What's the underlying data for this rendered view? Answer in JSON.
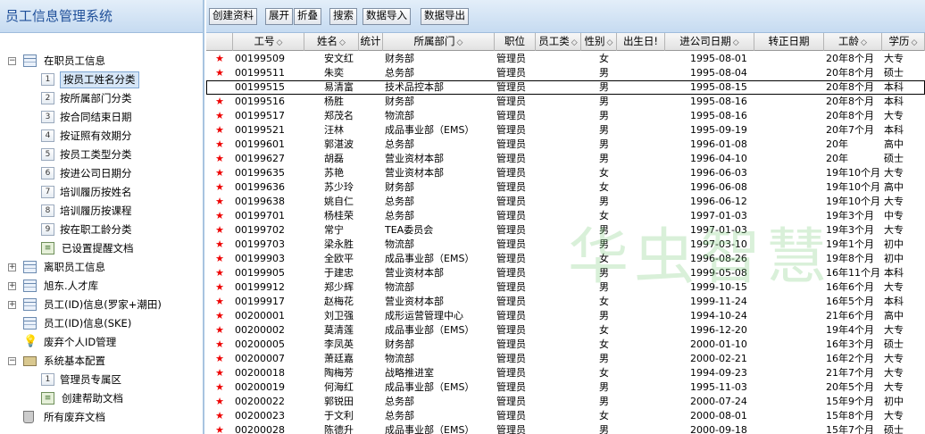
{
  "app_title": "员工信息管理系统",
  "toolbar": {
    "buttons": [
      "创建资料",
      "展开",
      "折叠",
      "搜索",
      "数据导入",
      "数据导出"
    ]
  },
  "tree": [
    {
      "expander": "⊟",
      "icon": "table",
      "label": "在职员工信息"
    },
    {
      "icon": "num",
      "num": "1",
      "label": "按员工姓名分类",
      "selected": true
    },
    {
      "icon": "num",
      "num": "2",
      "label": "按所属部门分类"
    },
    {
      "icon": "num",
      "num": "3",
      "label": "按合同结束日期"
    },
    {
      "icon": "num",
      "num": "4",
      "label": "按证照有效期分"
    },
    {
      "icon": "num",
      "num": "5",
      "label": "按员工类型分类"
    },
    {
      "icon": "num",
      "num": "6",
      "label": "按进公司日期分"
    },
    {
      "icon": "num",
      "num": "7",
      "label": "培训履历按姓名"
    },
    {
      "icon": "num",
      "num": "8",
      "label": "培训履历按课程"
    },
    {
      "icon": "num",
      "num": "9",
      "label": "按在职工龄分类"
    },
    {
      "icon": "doc",
      "label": "已设置提醒文档"
    },
    {
      "expander": "⊞",
      "icon": "table",
      "label": "离职员工信息"
    },
    {
      "expander": "⊞",
      "icon": "table",
      "label": "旭东.人才库"
    },
    {
      "expander": "⊞",
      "icon": "table",
      "label": "员工(ID)信息(罗家+潮田)"
    },
    {
      "icon": "table",
      "label": "员工(ID)信息(SKE)"
    },
    {
      "icon": "bulb",
      "label": "废弃个人ID管理"
    },
    {
      "expander": "⊟",
      "icon": "folder",
      "label": "系统基本配置"
    },
    {
      "icon": "num",
      "num": "1",
      "label": "管理员专属区"
    },
    {
      "icon": "doc",
      "label": "创建帮助文档"
    },
    {
      "icon": "trash",
      "label": "所有废弃文档"
    }
  ],
  "columns": [
    "工号",
    "姓名",
    "统计",
    "所属部门",
    "职位",
    "员工类",
    "性别",
    "出生日!",
    "进公司日期",
    "转正日期",
    "工龄",
    "学历"
  ],
  "rows": [
    {
      "star": "★",
      "id": "00199509",
      "name": "安文红",
      "dept": "财务部",
      "pos": "管理员",
      "sex": "女",
      "date": "1995-08-01",
      "years": "20年8个月",
      "edu": "大专"
    },
    {
      "star": "★",
      "id": "00199511",
      "name": "朱奕",
      "dept": "总务部",
      "pos": "管理员",
      "sex": "男",
      "date": "1995-08-04",
      "years": "20年8个月",
      "edu": "硕士"
    },
    {
      "star": "",
      "id": "00199515",
      "name": "易清富",
      "dept": "技术品控本部",
      "pos": "管理员",
      "sex": "男",
      "date": "1995-08-15",
      "years": "20年8个月",
      "edu": "本科",
      "current": true
    },
    {
      "star": "★",
      "id": "00199516",
      "name": "杨胜",
      "dept": "财务部",
      "pos": "管理员",
      "sex": "男",
      "date": "1995-08-16",
      "years": "20年8个月",
      "edu": "本科"
    },
    {
      "star": "★",
      "id": "00199517",
      "name": "郑茂名",
      "dept": "物流部",
      "pos": "管理员",
      "sex": "男",
      "date": "1995-08-16",
      "years": "20年8个月",
      "edu": "大专"
    },
    {
      "star": "★",
      "id": "00199521",
      "name": "汪林",
      "dept": "成品事业部（EMS）",
      "pos": "管理员",
      "sex": "男",
      "date": "1995-09-19",
      "years": "20年7个月",
      "edu": "本科"
    },
    {
      "star": "★",
      "id": "00199601",
      "name": "郭湛波",
      "dept": "总务部",
      "pos": "管理员",
      "sex": "男",
      "date": "1996-01-08",
      "years": "20年",
      "edu": "高中"
    },
    {
      "star": "★",
      "id": "00199627",
      "name": "胡磊",
      "dept": "营业资材本部",
      "pos": "管理员",
      "sex": "男",
      "date": "1996-04-10",
      "years": "20年",
      "edu": "硕士"
    },
    {
      "star": "★",
      "id": "00199635",
      "name": "苏艳",
      "dept": "营业资材本部",
      "pos": "管理员",
      "sex": "女",
      "date": "1996-06-03",
      "years": "19年10个月",
      "edu": "大专"
    },
    {
      "star": "★",
      "id": "00199636",
      "name": "苏少玲",
      "dept": "财务部",
      "pos": "管理员",
      "sex": "女",
      "date": "1996-06-08",
      "years": "19年10个月",
      "edu": "高中"
    },
    {
      "star": "★",
      "id": "00199638",
      "name": "姚自仁",
      "dept": "总务部",
      "pos": "管理员",
      "sex": "男",
      "date": "1996-06-12",
      "years": "19年10个月",
      "edu": "大专"
    },
    {
      "star": "★",
      "id": "00199701",
      "name": "杨桂荣",
      "dept": "总务部",
      "pos": "管理员",
      "sex": "女",
      "date": "1997-01-03",
      "years": "19年3个月",
      "edu": "中专"
    },
    {
      "star": "★",
      "id": "00199702",
      "name": "常宁",
      "dept": "TEA委员会",
      "pos": "管理员",
      "sex": "男",
      "date": "1997-01-03",
      "years": "19年3个月",
      "edu": "大专"
    },
    {
      "star": "★",
      "id": "00199703",
      "name": "梁永胜",
      "dept": "物流部",
      "pos": "管理员",
      "sex": "男",
      "date": "1997-03-10",
      "years": "19年1个月",
      "edu": "初中"
    },
    {
      "star": "★",
      "id": "00199903",
      "name": "全欧平",
      "dept": "成品事业部（EMS）",
      "pos": "管理员",
      "sex": "女",
      "date": "1996-08-26",
      "years": "19年8个月",
      "edu": "初中"
    },
    {
      "star": "★",
      "id": "00199905",
      "name": "于建忠",
      "dept": "营业资材本部",
      "pos": "管理员",
      "sex": "男",
      "date": "1999-05-08",
      "years": "16年11个月",
      "edu": "本科"
    },
    {
      "star": "★",
      "id": "00199912",
      "name": "郑少辉",
      "dept": "物流部",
      "pos": "管理员",
      "sex": "男",
      "date": "1999-10-15",
      "years": "16年6个月",
      "edu": "大专"
    },
    {
      "star": "★",
      "id": "00199917",
      "name": "赵梅花",
      "dept": "营业资材本部",
      "pos": "管理员",
      "sex": "女",
      "date": "1999-11-24",
      "years": "16年5个月",
      "edu": "本科"
    },
    {
      "star": "★",
      "id": "00200001",
      "name": "刘卫强",
      "dept": "成形运营管理中心",
      "pos": "管理员",
      "sex": "男",
      "date": "1994-10-24",
      "years": "21年6个月",
      "edu": "高中"
    },
    {
      "star": "★",
      "id": "00200002",
      "name": "莫清莲",
      "dept": "成品事业部（EMS）",
      "pos": "管理员",
      "sex": "女",
      "date": "1996-12-20",
      "years": "19年4个月",
      "edu": "大专"
    },
    {
      "star": "★",
      "id": "00200005",
      "name": "李凤英",
      "dept": "财务部",
      "pos": "管理员",
      "sex": "女",
      "date": "2000-01-10",
      "years": "16年3个月",
      "edu": "硕士"
    },
    {
      "star": "★",
      "id": "00200007",
      "name": "萧廷嘉",
      "dept": "物流部",
      "pos": "管理员",
      "sex": "男",
      "date": "2000-02-21",
      "years": "16年2个月",
      "edu": "大专"
    },
    {
      "star": "★",
      "id": "00200018",
      "name": "陶梅芳",
      "dept": "战略推进室",
      "pos": "管理员",
      "sex": "女",
      "date": "1994-09-23",
      "years": "21年7个月",
      "edu": "大专"
    },
    {
      "star": "★",
      "id": "00200019",
      "name": "何海红",
      "dept": "成品事业部（EMS）",
      "pos": "管理员",
      "sex": "男",
      "date": "1995-11-03",
      "years": "20年5个月",
      "edu": "大专"
    },
    {
      "star": "★",
      "id": "00200022",
      "name": "郭锐田",
      "dept": "总务部",
      "pos": "管理员",
      "sex": "男",
      "date": "2000-07-24",
      "years": "15年9个月",
      "edu": "初中"
    },
    {
      "star": "★",
      "id": "00200023",
      "name": "于文利",
      "dept": "总务部",
      "pos": "管理员",
      "sex": "女",
      "date": "2000-08-01",
      "years": "15年8个月",
      "edu": "大专"
    },
    {
      "star": "★",
      "id": "00200028",
      "name": "陈德升",
      "dept": "成品事业部（EMS）",
      "pos": "管理员",
      "sex": "男",
      "date": "2000-09-18",
      "years": "15年7个月",
      "edu": "硕士"
    }
  ],
  "watermark": "华虫智慧",
  "colors": {
    "accent": "#1f4f99",
    "star": "#e00000",
    "selected": "#d6e6f7"
  }
}
